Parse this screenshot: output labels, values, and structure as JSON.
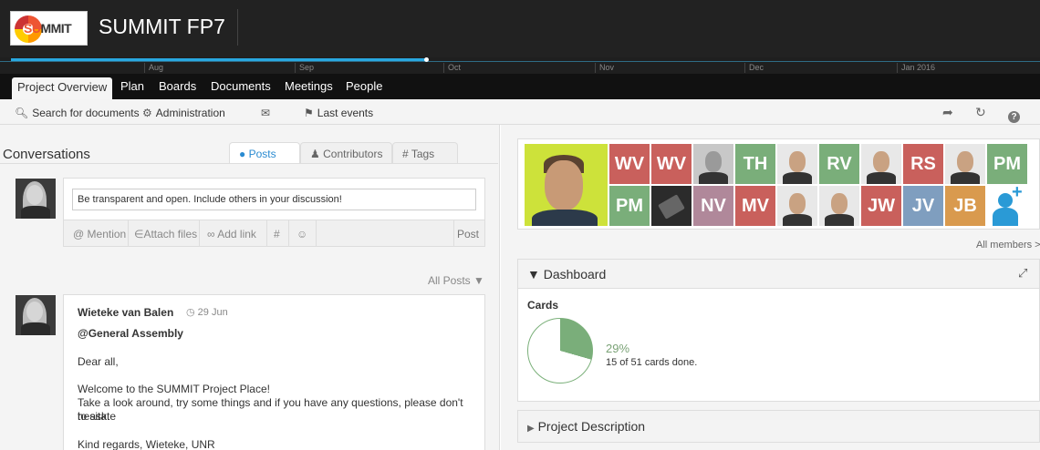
{
  "app": {
    "logo_text_main": "SU",
    "logo_text_mark": "MM",
    "logo_text_end": "IT",
    "title": "SUMMIT FP7"
  },
  "timeline": {
    "months": [
      "Aug",
      "Sep",
      "Oct",
      "Nov",
      "Dec",
      "Jan 2016"
    ],
    "progress_fraction": 0.4
  },
  "nav": {
    "tabs": [
      "Project Overview",
      "Plan",
      "Boards",
      "Documents",
      "Meetings",
      "People"
    ],
    "active": "Project Overview"
  },
  "toolbar": {
    "search_label": "Search for documents",
    "admin_label": "Administration",
    "events_label": "Last events"
  },
  "conversations": {
    "title": "Conversations",
    "tabs": {
      "posts": "Posts",
      "contributors": "Contributors",
      "tags": "Tags"
    },
    "composer": {
      "placeholder": "Be transparent and open. Include others in your discussion!",
      "mention": "Mention",
      "attach": "Attach files",
      "add_link": "Add link",
      "hash": "#",
      "post": "Post"
    },
    "filter_label": "All Posts",
    "post": {
      "author": "Wieteke van Balen",
      "date": "29 Jun",
      "group": "@General Assembly",
      "greeting": "Dear all,",
      "line1": "Welcome to the SUMMIT Project Place!",
      "line2": "Take a look around, try some things and if you have any questions, please don't hesitate",
      "line3": "to ask.",
      "signoff": "Kind regards, Wieteke, UNR"
    }
  },
  "members": {
    "initials_row1": [
      "WV",
      "WV",
      "TH",
      "RV",
      "RS",
      "PM"
    ],
    "initials_row2": [
      "PM",
      "NV",
      "MV",
      "JW",
      "JV",
      "JB"
    ],
    "colors": {
      "red": "#c9605c",
      "green": "#7aae7a",
      "mauve": "#b0889a",
      "blue": "#7f9ebf",
      "orange": "#d99a4e"
    },
    "all_members_label": "All members >"
  },
  "dashboard": {
    "title": "Dashboard",
    "cards_label": "Cards",
    "percent": "29%",
    "done_text": "15 of 51 cards done.",
    "done_fraction": 0.294
  },
  "project_description": {
    "title": "Project Description"
  }
}
